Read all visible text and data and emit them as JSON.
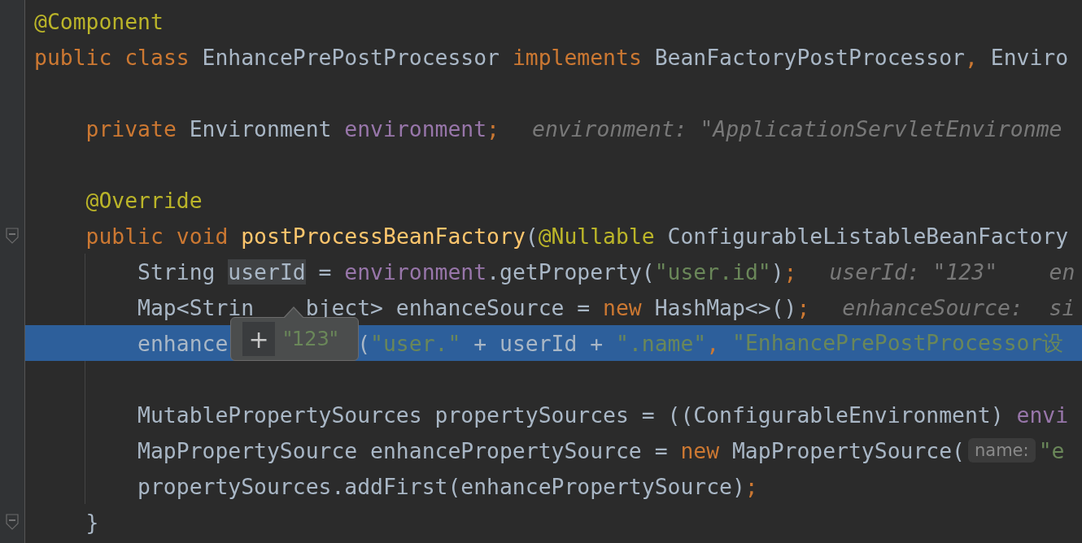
{
  "editor": {
    "lines": [
      {
        "kind": "top",
        "tokens": [
          {
            "kind": "annotation",
            "text": "@Component"
          }
        ]
      },
      {
        "kind": "top",
        "tokens": [
          {
            "kind": "keyword",
            "text": "public class "
          },
          {
            "kind": "plain",
            "text": "EnhancePrePostProcessor "
          },
          {
            "kind": "keyword",
            "text": "implements "
          },
          {
            "kind": "plain",
            "text": "BeanFactoryPostProcessor"
          },
          {
            "kind": "keyword",
            "text": ", "
          },
          {
            "kind": "plain",
            "text": "Enviro"
          }
        ]
      },
      {
        "kind": "blank"
      },
      {
        "kind": "member",
        "tokens": [
          {
            "kind": "keyword",
            "text": "private "
          },
          {
            "kind": "plain",
            "text": "Environment "
          },
          {
            "kind": "field",
            "text": "environment"
          },
          {
            "kind": "keyword",
            "text": ";"
          },
          {
            "kind": "inline_value",
            "text": "environment: \"ApplicationServletEnvironme"
          }
        ]
      },
      {
        "kind": "blank"
      },
      {
        "kind": "member",
        "tokens": [
          {
            "kind": "annotation",
            "text": "@Override"
          }
        ]
      },
      {
        "kind": "member",
        "fold": true,
        "tokens": [
          {
            "kind": "keyword",
            "text": "public void "
          },
          {
            "kind": "method",
            "text": "postProcessBeanFactory"
          },
          {
            "kind": "plain",
            "text": "("
          },
          {
            "kind": "annotation",
            "text": "@Nullable "
          },
          {
            "kind": "plain",
            "text": "ConfigurableListableBeanFactory"
          }
        ]
      },
      {
        "kind": "body",
        "tokens": [
          {
            "kind": "plain",
            "text": "String "
          },
          {
            "kind": "highlight",
            "text": "userId"
          },
          {
            "kind": "plain",
            "text": " = "
          },
          {
            "kind": "field",
            "text": "environment"
          },
          {
            "kind": "plain",
            "text": ".getProperty("
          },
          {
            "kind": "string",
            "text": "\"user.id\""
          },
          {
            "kind": "plain",
            "text": ")"
          },
          {
            "kind": "keyword",
            "text": ";"
          },
          {
            "kind": "inline_value",
            "text": "userId: \"123\"    en"
          }
        ]
      },
      {
        "kind": "body",
        "tokens": [
          {
            "kind": "plain",
            "text": "Map<Strin"
          },
          {
            "kind": "plain_after_arrow",
            "text": "bject> enhanceSource = "
          },
          {
            "kind": "keyword",
            "text": "new "
          },
          {
            "kind": "plain",
            "text": "HashMap<>()"
          },
          {
            "kind": "keyword",
            "text": ";"
          },
          {
            "kind": "inline_value",
            "text": "enhanceSource:  si"
          }
        ]
      },
      {
        "kind": "body",
        "selected": true,
        "popup": {
          "button": "+",
          "value": "\"123\""
        },
        "tokens": [
          {
            "kind": "plain",
            "text": "enhance"
          },
          {
            "kind": "plain_after_popup",
            "text": "("
          },
          {
            "kind": "string",
            "text": "\"user.\""
          },
          {
            "kind": "plain",
            "text": " + userId + "
          },
          {
            "kind": "string",
            "text": "\".name\""
          },
          {
            "kind": "keyword",
            "text": ", "
          },
          {
            "kind": "string",
            "text": "\"EnhancePrePostProcessor设"
          }
        ]
      },
      {
        "kind": "blank"
      },
      {
        "kind": "body",
        "tokens": [
          {
            "kind": "plain",
            "text": "MutablePropertySources propertySources = ((ConfigurableEnvironment) "
          },
          {
            "kind": "field",
            "text": "envi"
          }
        ]
      },
      {
        "kind": "body",
        "tokens": [
          {
            "kind": "plain",
            "text": "MapPropertySource enhancePropertySource = "
          },
          {
            "kind": "keyword",
            "text": "new "
          },
          {
            "kind": "plain",
            "text": "MapPropertySource("
          },
          {
            "kind": "param_hint",
            "text": "name:"
          },
          {
            "kind": "string",
            "text": "\"e"
          }
        ]
      },
      {
        "kind": "body",
        "tokens": [
          {
            "kind": "plain",
            "text": "propertySources.addFirst(enhancePropertySource)"
          },
          {
            "kind": "keyword",
            "text": ";"
          }
        ]
      },
      {
        "kind": "member",
        "fold": true,
        "tokens": [
          {
            "kind": "plain",
            "text": "}"
          }
        ]
      }
    ]
  }
}
